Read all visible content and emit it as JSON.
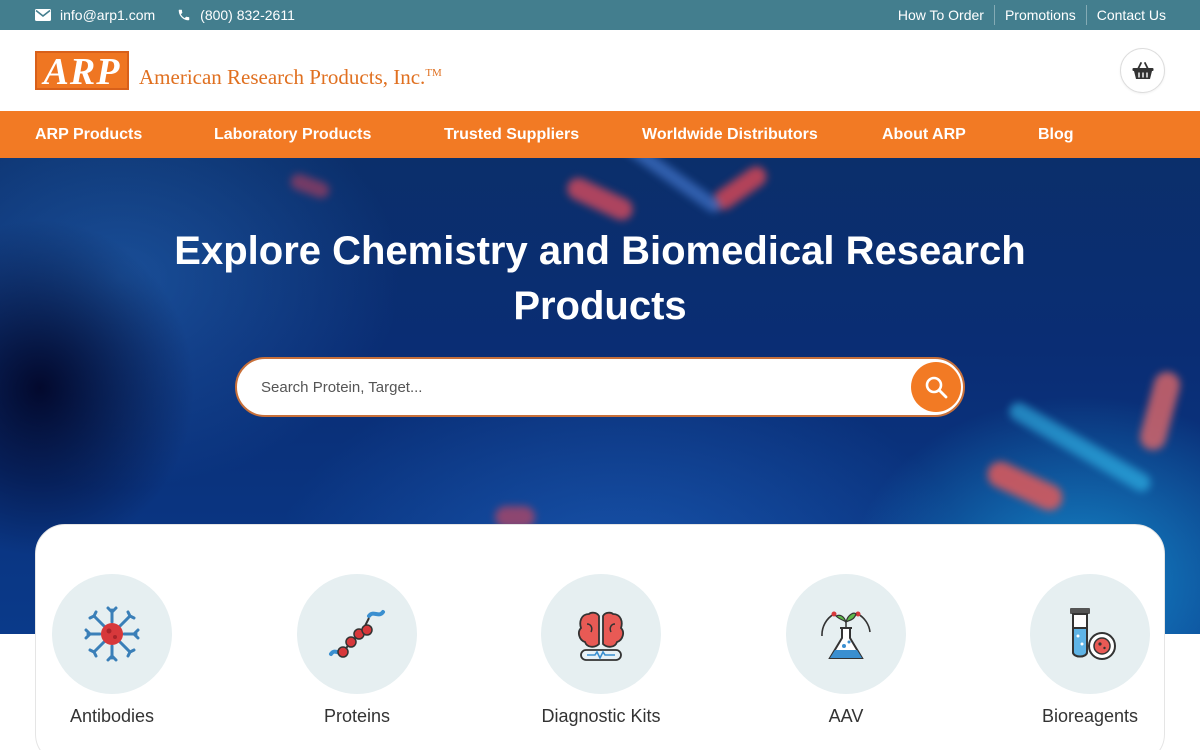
{
  "topbar": {
    "email": "info@arp1.com",
    "phone": "(800) 832-2611",
    "links": [
      "How To Order",
      "Promotions",
      "Contact Us"
    ]
  },
  "header": {
    "logo_mark": "ARP",
    "company_name": "American Research Products, Inc.",
    "trademark": "TM"
  },
  "nav": [
    "ARP Products",
    "Laboratory Products",
    "Trusted Suppliers",
    "Worldwide Distributors",
    "About ARP",
    "Blog"
  ],
  "hero": {
    "title": "Explore Chemistry and Biomedical Research Products",
    "search_placeholder": "Search Protein, Target..."
  },
  "categories": [
    {
      "label": "Antibodies",
      "icon": "antibody-icon"
    },
    {
      "label": "Proteins",
      "icon": "protein-icon"
    },
    {
      "label": "Diagnostic Kits",
      "icon": "brain-icon"
    },
    {
      "label": "AAV",
      "icon": "flask-icon"
    },
    {
      "label": "Bioreagents",
      "icon": "test-tube-icon"
    }
  ],
  "colors": {
    "topbar": "#437e8e",
    "brand_orange": "#f27a24",
    "category_circle": "#e6eff1"
  }
}
